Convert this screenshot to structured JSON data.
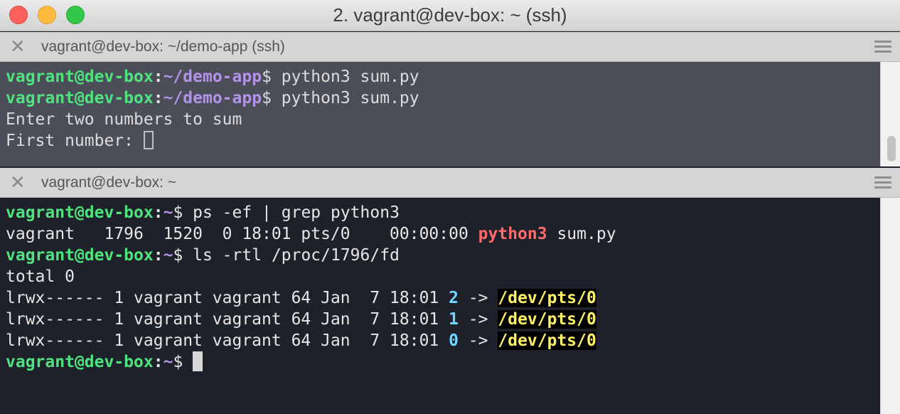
{
  "window": {
    "title": "2. vagrant@dev-box: ~ (ssh)"
  },
  "panes": [
    {
      "title": "vagrant@dev-box: ~/demo-app (ssh)",
      "lines": [
        {
          "user": "vagrant@dev-box",
          "colon": ":",
          "path": "~/demo-app",
          "cmd": "$ python3 sum.py"
        },
        {
          "user": "vagrant@dev-box",
          "colon": ":",
          "path": "~/demo-app",
          "cmd": "$ python3 sum.py"
        },
        {
          "text": "Enter two numbers to sum"
        },
        {
          "text": "First number: "
        }
      ]
    },
    {
      "title": "vagrant@dev-box: ~",
      "lines": [
        {
          "user": "vagrant@dev-box",
          "colon": ":",
          "path": "~",
          "cmd": "$ ps -ef | grep python3"
        },
        {
          "pre": "vagrant   1796  1520  0 18:01 pts/0    00:00:00 ",
          "highlight": "python3",
          "post": " sum.py"
        },
        {
          "user": "vagrant@dev-box",
          "colon": ":",
          "path": "~",
          "cmd": "$ ls -rtl /proc/1796/fd"
        },
        {
          "text": "total 0"
        },
        {
          "pre": "lrwx------ 1 vagrant vagrant 64 Jan  7 18:01 ",
          "fd": "2",
          "arrow": " -> ",
          "target": "/dev/pts/0"
        },
        {
          "pre": "lrwx------ 1 vagrant vagrant 64 Jan  7 18:01 ",
          "fd": "1",
          "arrow": " -> ",
          "target": "/dev/pts/0"
        },
        {
          "pre": "lrwx------ 1 vagrant vagrant 64 Jan  7 18:01 ",
          "fd": "0",
          "arrow": " -> ",
          "target": "/dev/pts/0"
        },
        {
          "user": "vagrant@dev-box",
          "colon": ":",
          "path": "~",
          "cmd": "$ "
        }
      ]
    }
  ],
  "icons": {
    "close_pane": "close-icon",
    "pane_menu": "hamburger-menu-icon"
  },
  "colors": {
    "prompt_user": "#4ee37f",
    "prompt_path": "#b294e6",
    "process_highlight": "#ff6b6b",
    "fd_number": "#6fd6ff",
    "dev_path": "#fff267"
  }
}
